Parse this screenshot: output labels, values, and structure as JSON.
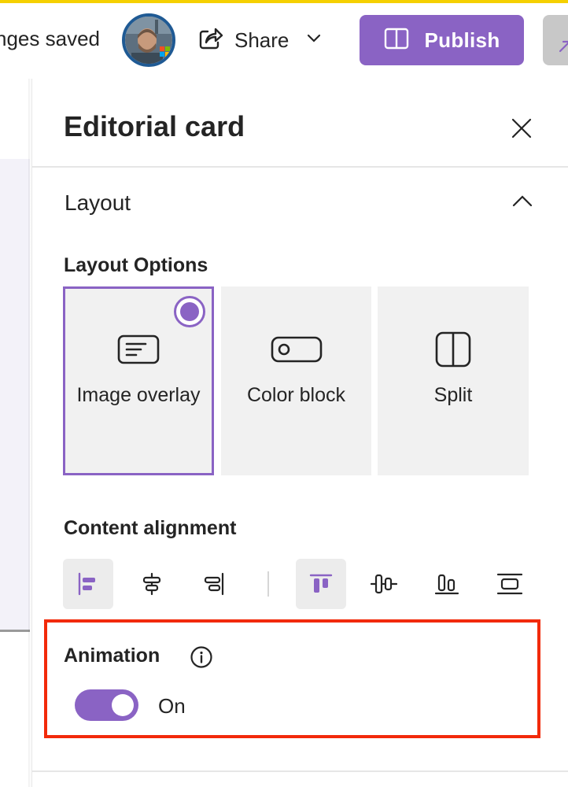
{
  "topbar": {
    "save_status": "nges saved",
    "share_label": "Share",
    "publish_label": "Publish"
  },
  "panel": {
    "title": "Editorial card",
    "section_title": "Layout",
    "layout_options_label": "Layout Options",
    "layout_options": [
      {
        "label": "Image overlay",
        "icon": "text-card-icon",
        "selected": true
      },
      {
        "label": "Color block",
        "icon": "toggle-pill-icon",
        "selected": false
      },
      {
        "label": "Split",
        "icon": "split-column-icon",
        "selected": false
      }
    ],
    "content_alignment_label": "Content alignment",
    "alignment_buttons": [
      {
        "icon": "align-left-icon",
        "active": true
      },
      {
        "icon": "align-center-horizontal-icon",
        "active": false
      },
      {
        "icon": "align-right-icon",
        "active": false
      },
      {
        "icon": "align-top-icon",
        "active": true
      },
      {
        "icon": "align-middle-vertical-icon",
        "active": false
      },
      {
        "icon": "align-bottom-icon",
        "active": false
      },
      {
        "icon": "distribute-vertical-icon",
        "active": false
      }
    ],
    "animation": {
      "label": "Animation",
      "state_text": "On",
      "enabled": true
    }
  },
  "colors": {
    "accent": "#8a63c4",
    "highlight": "#f22a0a",
    "top_line": "#f5d000"
  }
}
